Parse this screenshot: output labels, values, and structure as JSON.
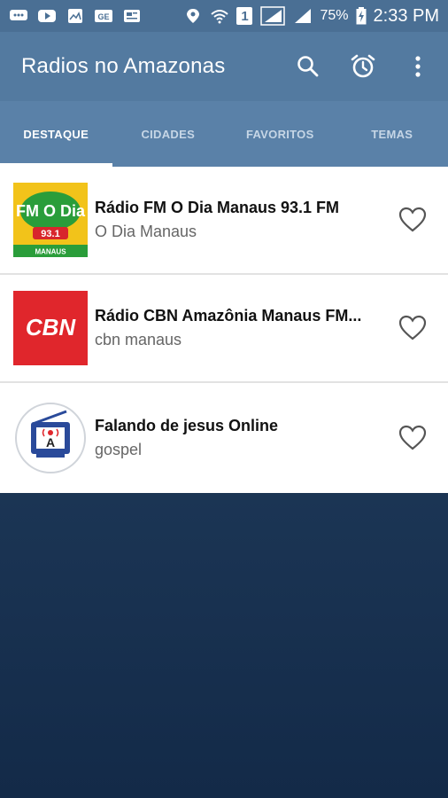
{
  "status_bar": {
    "battery": "75%",
    "time": "2:33 PM",
    "sim_label": "1"
  },
  "app_bar": {
    "title": "Radios no Amazonas",
    "icons": [
      "search-icon",
      "alarm-icon",
      "more-vert-icon"
    ]
  },
  "tabs": [
    {
      "label": "DESTAQUE",
      "active": true
    },
    {
      "label": "CIDADES",
      "active": false
    },
    {
      "label": "FAVORITOS",
      "active": false
    },
    {
      "label": "TEMAS",
      "active": false
    }
  ],
  "stations": [
    {
      "title": "Rádio FM O Dia Manaus 93.1 FM",
      "subtitle": "O Dia Manaus",
      "logo_text": "FM O Dia",
      "logo_freq": "93.1",
      "logo_city": "MANAUS"
    },
    {
      "title": "Rádio CBN Amazônia Manaus FM...",
      "subtitle": "cbn manaus",
      "logo_text": "CBN"
    },
    {
      "title": "Falando de jesus Online",
      "subtitle": "gospel",
      "logo_text": "A"
    }
  ],
  "colors": {
    "status_bar": "#4a6f94",
    "app_bar": "#537aa0",
    "tabs": "#5a81a8",
    "background_gradient_top": "#2b4a6d",
    "background_gradient_bottom": "#132a48",
    "cbn_red": "#e0262c",
    "odia_yellow": "#f2c31a"
  }
}
